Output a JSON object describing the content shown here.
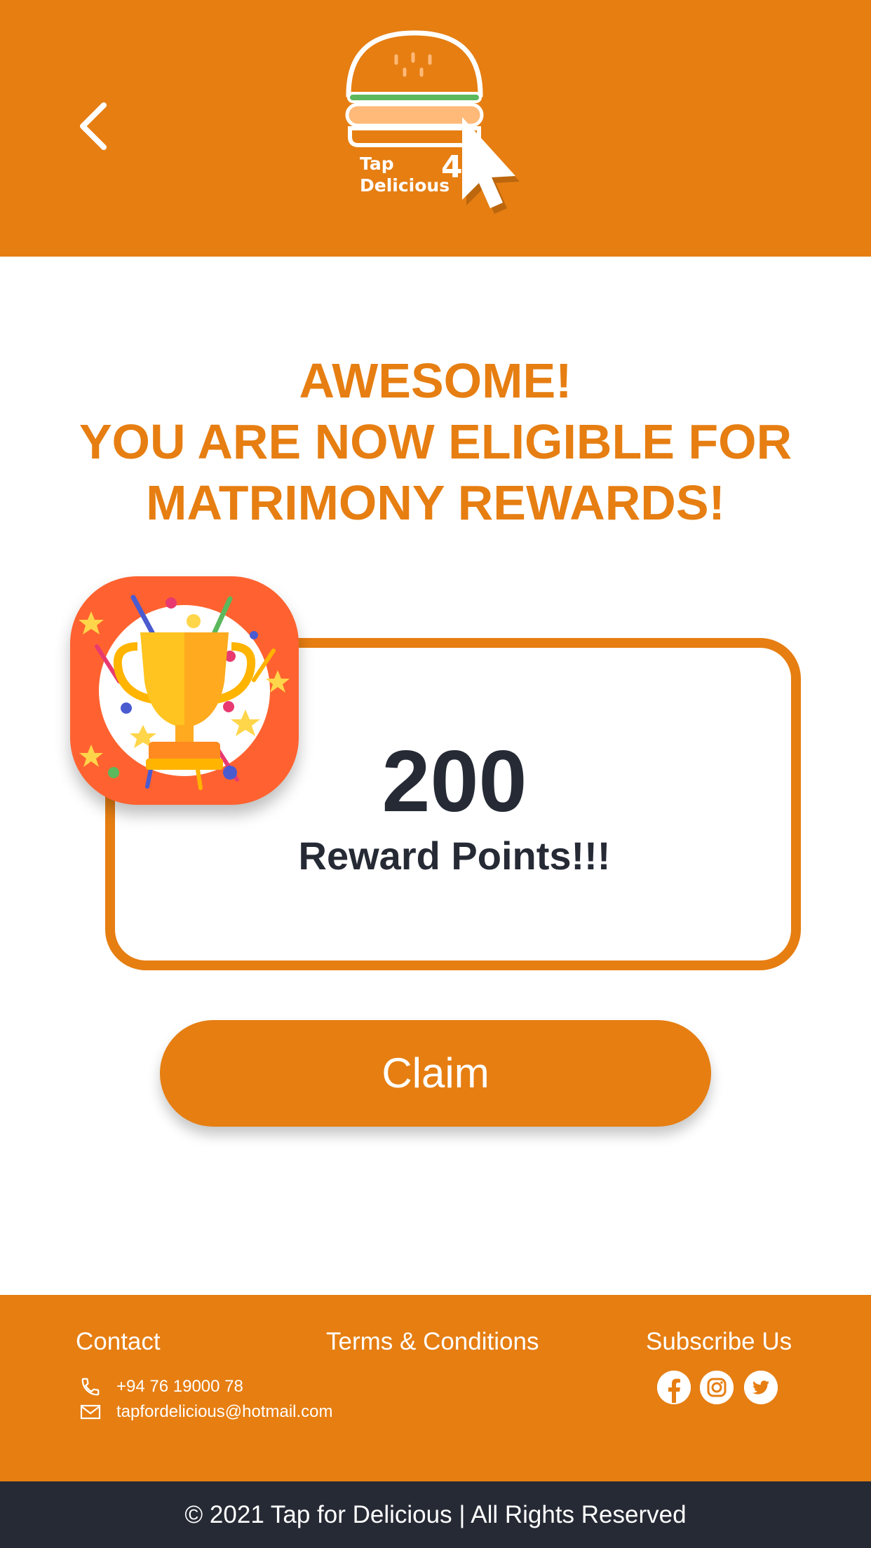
{
  "header": {
    "back_icon": "chevron-left-icon",
    "logo": {
      "line1": "Tap",
      "line2": "Delicious",
      "mark": "4"
    }
  },
  "headline": {
    "line1": "AWESOME!",
    "line2": "YOU ARE NOW ELIGIBLE FOR",
    "line3": "MATRIMONY REWARDS!"
  },
  "reward": {
    "points": "200",
    "label": "Reward Points!!!",
    "badge_icon": "trophy-icon"
  },
  "claim_button": {
    "label": "Claim"
  },
  "footer": {
    "contact": {
      "title": "Contact",
      "phone": "+94 76 19000 78",
      "email": "tapfordelicious@hotmail.com"
    },
    "terms": {
      "title": "Terms & Conditions"
    },
    "subscribe": {
      "title": "Subscribe Us",
      "icons": [
        "facebook-icon",
        "instagram-icon",
        "twitter-icon"
      ]
    }
  },
  "copyright": "© 2021 Tap for Delicious | All Rights Reserved",
  "colors": {
    "brand_orange": "#E67E12",
    "dark": "#262A35",
    "trophy_badge_bg": "#FF6230"
  }
}
